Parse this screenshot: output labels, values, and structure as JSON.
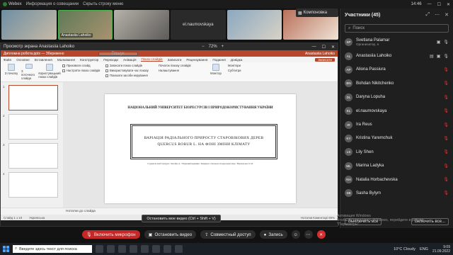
{
  "topbar": {
    "app": "Webex",
    "meeting_info": "Информация о совещании",
    "hide_bar": "Скрыть строку меню",
    "time": "14:46"
  },
  "tiles": [
    {
      "name": "",
      "style": "t1"
    },
    {
      "name": "Anastasiia Lahoiko",
      "style": "t2"
    },
    {
      "name": "",
      "style": "t3"
    },
    {
      "name": "el.naumovskaya",
      "style": "t4"
    },
    {
      "name": "",
      "style": "t5"
    },
    {
      "name": "",
      "style": "t6"
    }
  ],
  "companion": "Компоновка",
  "share": {
    "title": "Просмотр экрана Anastasiia Lahoiko",
    "zoom": "72%",
    "ppt_title": "Дипломна робота.pptx — Збережено",
    "ppt_search": "Пошук",
    "ppt_user": "Anastasiia Lahoiko",
    "tabs": [
      "Файл",
      "Основне",
      "Вставлення",
      "Малювання",
      "Конструктор",
      "Переходи",
      "Анімація",
      "Показ слайдів",
      "Записати",
      "Рецензування",
      "Подання",
      "Довідка"
    ],
    "active_tab": "Показ слайдів",
    "share_button": "Записати",
    "ribbon_buttons": [
      "З початку",
      "З поточного слайда",
      "Користувацький показ слайдів"
    ],
    "ribbon_options": [
      "Приховати слайд",
      "Настроїти показ слайдів",
      "Записати показ слайдів",
      "Використовувати час показу",
      "Показати засоби керування"
    ],
    "ribbon_groups": [
      "Початок показу слайдів",
      "Налаштування",
      "Монітори",
      "Субтитри"
    ],
    "monitor": "Монітор",
    "slide": {
      "university": "НАЦІОНАЛЬНИЙ УНІВЕРСИТЕТ БІОРЕСУРСІВ І ПРИРОДОКОРИСТУВАННЯ УКРАЇНИ",
      "title": "ВАРІАЦІЯ РАДІАЛЬНОГО ПРИРОСТУ СТАРОВІКОВИХ ДЕРЕВ QUERCUS ROBUR L. НА ФОНІ ЗМІНИ КЛІМАТУ",
      "authors": "Студентка магістратури / Лагойко А. / Науковий керівник / Кандидат сільськогосподарських наук / Наумовська О. М."
    },
    "notes": "Нотатки до слайда",
    "status_left": "Слайд 1 з 10",
    "status_lang": "Українська",
    "status_right": "Нотатки  Коментарі  69%"
  },
  "tooltip": "Остановить мое видео (Ctrl + Shift + V)",
  "panel": {
    "title": "Участники (45)",
    "search_placeholder": "Поиск",
    "participants": [
      {
        "initials": "SP",
        "name": "Svetlana Palamar",
        "role": "Организатор, я",
        "mic_off": false
      },
      {
        "initials": "AL",
        "name": "Anastasiia Lahoiko",
        "role": "",
        "mic_off": false
      },
      {
        "initials": "AP",
        "name": "Aliona Passiura",
        "role": "",
        "mic_off": true
      },
      {
        "initials": "BN",
        "name": "Bohdan Nikitchenko",
        "role": "",
        "mic_off": true
      },
      {
        "initials": "DL",
        "name": "Daryna Lopuha",
        "role": "",
        "mic_off": true
      },
      {
        "initials": "EL",
        "name": "el.naumovskaya",
        "role": "",
        "mic_off": true
      },
      {
        "initials": "IR",
        "name": "Ira Reus",
        "role": "",
        "mic_off": true
      },
      {
        "initials": "KY",
        "name": "Kristina Yaremchuk",
        "role": "",
        "mic_off": true
      },
      {
        "initials": "LS",
        "name": "Lily Shen",
        "role": "",
        "mic_off": true
      },
      {
        "initials": "ML",
        "name": "Marina Ladyka",
        "role": "",
        "mic_off": true
      },
      {
        "initials": "NH",
        "name": "Natalia Horbachevska",
        "role": "",
        "mic_off": true
      },
      {
        "initials": "SB",
        "name": "Sasha Bylym",
        "role": "",
        "mic_off": true
      }
    ],
    "mute_all": "Включить все...",
    "unmute_all": "Выключить все"
  },
  "activation": {
    "title": "Активация Windows",
    "line1": "Чтобы активировать Windows, перейдите в раздел",
    "line2": "\"Параметры\"."
  },
  "controls": {
    "mic": "Включить микрофон",
    "video": "Остановить видео",
    "share": "Совместный доступ",
    "record": "Запись"
  },
  "taskbar": {
    "search": "Введите здесь текст для поиска",
    "weather": "10°C Cloudy",
    "lang": "ENG",
    "time": "9:09",
    "date": "21.09.2022"
  }
}
